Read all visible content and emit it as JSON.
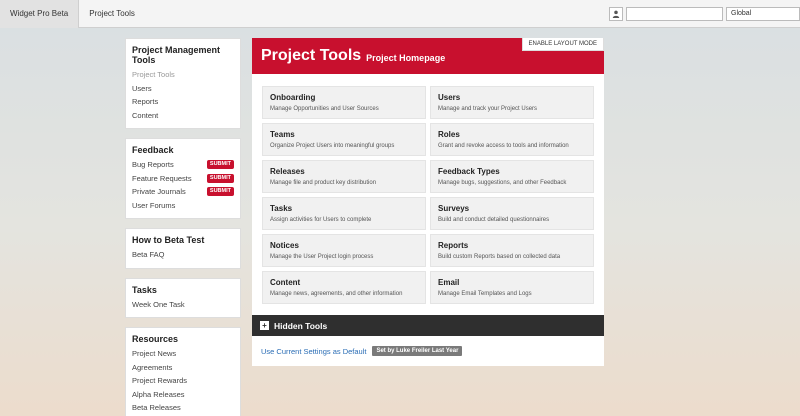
{
  "topbar": {
    "tabs": [
      {
        "label": "Widget Pro Beta",
        "active": true
      },
      {
        "label": "Project Tools",
        "active": false
      }
    ],
    "search_value": "",
    "scope": "Global"
  },
  "sidebar": {
    "panels": [
      {
        "title": "Project Management Tools",
        "items": [
          {
            "label": "Project Tools",
            "muted": true
          },
          {
            "label": "Users"
          },
          {
            "label": "Reports"
          },
          {
            "label": "Content"
          }
        ]
      },
      {
        "title": "Feedback",
        "items": [
          {
            "label": "Bug Reports",
            "badge": "SUBMIT"
          },
          {
            "label": "Feature Requests",
            "badge": "SUBMIT"
          },
          {
            "label": "Private Journals",
            "badge": "SUBMIT"
          },
          {
            "label": "User Forums"
          }
        ]
      },
      {
        "title": "How to Beta Test",
        "items": [
          {
            "label": "Beta FAQ"
          }
        ]
      },
      {
        "title": "Tasks",
        "items": [
          {
            "label": "Week One Task"
          }
        ]
      },
      {
        "title": "Resources",
        "items": [
          {
            "label": "Project News"
          },
          {
            "label": "Agreements"
          },
          {
            "label": "Project Rewards"
          },
          {
            "label": "Alpha Releases"
          },
          {
            "label": "Beta Releases"
          }
        ]
      }
    ]
  },
  "main": {
    "title": "Project Tools",
    "subtitle": "Project Homepage",
    "layout_button": "ENABLE LAYOUT MODE",
    "accent_color": "#c8102e",
    "tiles": [
      {
        "name": "Onboarding",
        "desc": "Manage Opportunities and User Sources"
      },
      {
        "name": "Users",
        "desc": "Manage and track your Project Users"
      },
      {
        "name": "Teams",
        "desc": "Organize Project Users into meaningful groups"
      },
      {
        "name": "Roles",
        "desc": "Grant and revoke access to tools and information"
      },
      {
        "name": "Releases",
        "desc": "Manage file and product key distribution"
      },
      {
        "name": "Feedback Types",
        "desc": "Manage bugs, suggestions, and other Feedback"
      },
      {
        "name": "Tasks",
        "desc": "Assign activities for Users to complete"
      },
      {
        "name": "Surveys",
        "desc": "Build and conduct detailed questionnaires"
      },
      {
        "name": "Notices",
        "desc": "Manage the User Project login process"
      },
      {
        "name": "Reports",
        "desc": "Build custom Reports based on collected data"
      },
      {
        "name": "Content",
        "desc": "Manage news, agreements, and other information"
      },
      {
        "name": "Email",
        "desc": "Manage Email Templates and Logs"
      }
    ],
    "hidden_tools": "Hidden Tools",
    "footer_link": "Use Current Settings as Default",
    "footer_badge": "Set by Luke Freiler Last Year"
  }
}
